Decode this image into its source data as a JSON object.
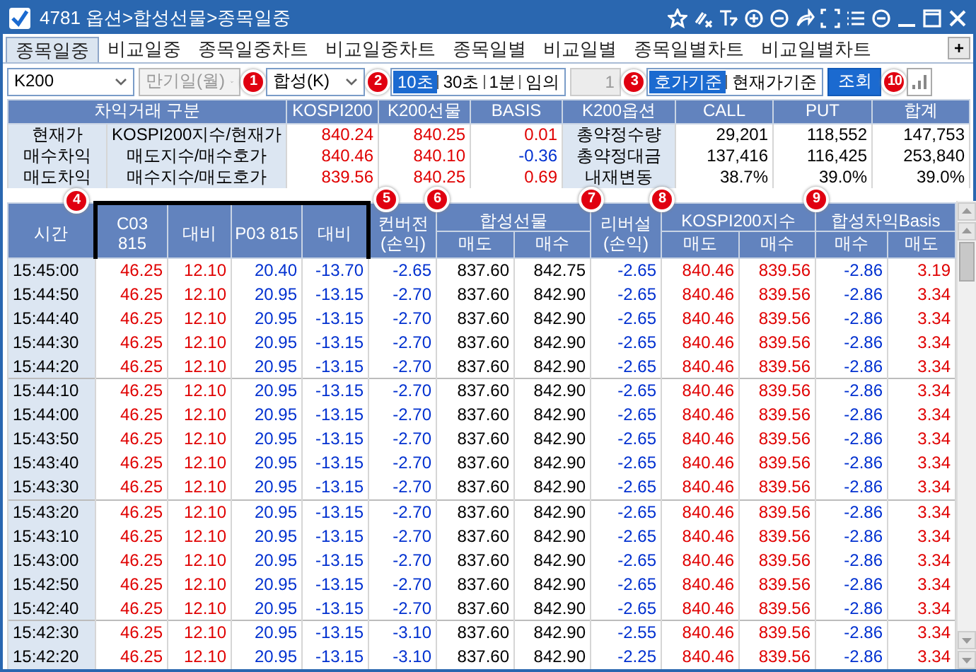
{
  "title_bar": {
    "title": "4781 옵션>합성선물>종목일중"
  },
  "tabs": [
    {
      "label": "종목일중",
      "selected": true
    },
    {
      "label": "비교일중",
      "selected": false
    },
    {
      "label": "종목일중차트",
      "selected": false
    },
    {
      "label": "비교일중차트",
      "selected": false
    },
    {
      "label": "종목일별",
      "selected": false
    },
    {
      "label": "비교일별",
      "selected": false
    },
    {
      "label": "종목일별차트",
      "selected": false
    },
    {
      "label": "비교일별차트",
      "selected": false
    }
  ],
  "add_tab": "+",
  "controls": {
    "symbol_select": {
      "value": "K200"
    },
    "expiry_select": {
      "value": "만기일(월)",
      "disabled": true
    },
    "type_select": {
      "value": "합성(K)",
      "callout": "1"
    },
    "intervals": {
      "callout": "2",
      "options": [
        {
          "label": "10초",
          "selected": true
        },
        {
          "label": "30초",
          "selected": false
        },
        {
          "label": "1분",
          "selected": false
        },
        {
          "label": "임의",
          "selected": false
        }
      ]
    },
    "count_field": {
      "value": "1",
      "disabled": true
    },
    "basis": {
      "callout": "3",
      "options": [
        {
          "label": "호가기준",
          "selected": true
        },
        {
          "label": "현재가기준",
          "selected": false
        }
      ]
    },
    "query_button": {
      "label": "조회",
      "callout": "10"
    }
  },
  "summary": {
    "columns": [
      "차익거래 구분",
      "KOSPI200",
      "K200선물",
      "BASIS",
      "K200옵션",
      "CALL",
      "PUT",
      "합계"
    ],
    "rows": [
      {
        "label": "현재가",
        "sublabel": "KOSPI200지수/현재가",
        "kospi": {
          "text": "840.24",
          "color": "#e00000"
        },
        "futures": {
          "text": "840.25",
          "color": "#e00000"
        },
        "basis": {
          "text": "0.01",
          "color": "#e00000"
        },
        "option_label": "총약정수량",
        "call": "29,201",
        "put": "118,552",
        "total": "147,753"
      },
      {
        "label": "매수차익",
        "sublabel": "매도지수/매수호가",
        "kospi": {
          "text": "840.46",
          "color": "#e00000"
        },
        "futures": {
          "text": "840.10",
          "color": "#e00000"
        },
        "basis": {
          "text": "-0.36",
          "color": "#0030d0"
        },
        "option_label": "총약정대금",
        "call": "137,416",
        "put": "116,425",
        "total": "253,840"
      },
      {
        "label": "매도차익",
        "sublabel": "매수지수/매도호가",
        "kospi": {
          "text": "839.56",
          "color": "#e00000"
        },
        "futures": {
          "text": "840.25",
          "color": "#e00000"
        },
        "basis": {
          "text": "0.69",
          "color": "#e00000"
        },
        "option_label": "내재변동",
        "call": "38.7%",
        "put": "39.0%",
        "total": "39.0%"
      }
    ]
  },
  "table": {
    "columns": [
      {
        "label": "시간",
        "color": "#000000"
      },
      {
        "label": "C03 815",
        "color": "#e00000",
        "highlighted": true,
        "callout": "4"
      },
      {
        "label": "대비",
        "color": "#e00000",
        "highlighted": true
      },
      {
        "label": "P03 815",
        "color": "#0030d0",
        "highlighted": true
      },
      {
        "label": "대비",
        "color": "#0030d0",
        "highlighted": true
      },
      {
        "label": "컨버전\n(손익)",
        "color": "#0030d0",
        "callout": "5"
      },
      {
        "label": "합성선물",
        "colspan": 2,
        "callout": "6",
        "subcolumns": [
          {
            "label": "매도",
            "color": "#000000"
          },
          {
            "label": "매수",
            "color": "#000000"
          }
        ]
      },
      {
        "label": "리버설\n(손익)",
        "color": "#0030d0",
        "callout": "7"
      },
      {
        "label": "KOSPI200지수",
        "colspan": 2,
        "callout": "8",
        "subcolumns": [
          {
            "label": "매도",
            "color": "#e00000"
          },
          {
            "label": "매수",
            "color": "#e00000"
          }
        ]
      },
      {
        "label": "합성차익Basis",
        "colspan": 2,
        "callout": "9",
        "subcolumns": [
          {
            "label": "매수",
            "color": "#0030d0"
          },
          {
            "label": "매도",
            "color": "#e00000"
          }
        ]
      }
    ],
    "rows": [
      [
        "15:45:00",
        "46.25",
        "12.10",
        "20.40",
        "-13.70",
        "-2.65",
        "837.60",
        "842.75",
        "-2.65",
        "840.46",
        "839.56",
        "-2.86",
        "3.19"
      ],
      [
        "15:44:50",
        "46.25",
        "12.10",
        "20.95",
        "-13.15",
        "-2.70",
        "837.60",
        "842.90",
        "-2.65",
        "840.46",
        "839.56",
        "-2.86",
        "3.34"
      ],
      [
        "15:44:40",
        "46.25",
        "12.10",
        "20.95",
        "-13.15",
        "-2.70",
        "837.60",
        "842.90",
        "-2.65",
        "840.46",
        "839.56",
        "-2.86",
        "3.34"
      ],
      [
        "15:44:30",
        "46.25",
        "12.10",
        "20.95",
        "-13.15",
        "-2.70",
        "837.60",
        "842.90",
        "-2.65",
        "840.46",
        "839.56",
        "-2.86",
        "3.34"
      ],
      [
        "15:44:20",
        "46.25",
        "12.10",
        "20.95",
        "-13.15",
        "-2.70",
        "837.60",
        "842.90",
        "-2.65",
        "840.46",
        "839.56",
        "-2.86",
        "3.34"
      ],
      [
        "15:44:10",
        "46.25",
        "12.10",
        "20.95",
        "-13.15",
        "-2.70",
        "837.60",
        "842.90",
        "-2.65",
        "840.46",
        "839.56",
        "-2.86",
        "3.34"
      ],
      [
        "15:44:00",
        "46.25",
        "12.10",
        "20.95",
        "-13.15",
        "-2.70",
        "837.60",
        "842.90",
        "-2.65",
        "840.46",
        "839.56",
        "-2.86",
        "3.34"
      ],
      [
        "15:43:50",
        "46.25",
        "12.10",
        "20.95",
        "-13.15",
        "-2.70",
        "837.60",
        "842.90",
        "-2.65",
        "840.46",
        "839.56",
        "-2.86",
        "3.34"
      ],
      [
        "15:43:40",
        "46.25",
        "12.10",
        "20.95",
        "-13.15",
        "-2.70",
        "837.60",
        "842.90",
        "-2.65",
        "840.46",
        "839.56",
        "-2.86",
        "3.34"
      ],
      [
        "15:43:30",
        "46.25",
        "12.10",
        "20.95",
        "-13.15",
        "-2.70",
        "837.60",
        "842.90",
        "-2.65",
        "840.46",
        "839.56",
        "-2.86",
        "3.34"
      ],
      [
        "15:43:20",
        "46.25",
        "12.10",
        "20.95",
        "-13.15",
        "-2.70",
        "837.60",
        "842.90",
        "-2.65",
        "840.46",
        "839.56",
        "-2.86",
        "3.34"
      ],
      [
        "15:43:10",
        "46.25",
        "12.10",
        "20.95",
        "-13.15",
        "-2.70",
        "837.60",
        "842.90",
        "-2.65",
        "840.46",
        "839.56",
        "-2.86",
        "3.34"
      ],
      [
        "15:43:00",
        "46.25",
        "12.10",
        "20.95",
        "-13.15",
        "-2.70",
        "837.60",
        "842.90",
        "-2.65",
        "840.46",
        "839.56",
        "-2.86",
        "3.34"
      ],
      [
        "15:42:50",
        "46.25",
        "12.10",
        "20.95",
        "-13.15",
        "-2.70",
        "837.60",
        "842.90",
        "-2.65",
        "840.46",
        "839.56",
        "-2.86",
        "3.34"
      ],
      [
        "15:42:40",
        "46.25",
        "12.10",
        "20.95",
        "-13.15",
        "-2.70",
        "837.60",
        "842.90",
        "-2.65",
        "840.46",
        "839.56",
        "-2.86",
        "3.34"
      ],
      [
        "15:42:30",
        "46.25",
        "12.10",
        "20.95",
        "-13.15",
        "-3.10",
        "837.60",
        "842.90",
        "-2.55",
        "840.46",
        "839.56",
        "-2.86",
        "3.34"
      ],
      [
        "15:42:20",
        "46.25",
        "12.10",
        "20.95",
        "-13.15",
        "-3.10",
        "837.60",
        "842.90",
        "-2.25",
        "840.46",
        "839.56",
        "-2.86",
        "3.34"
      ]
    ]
  }
}
